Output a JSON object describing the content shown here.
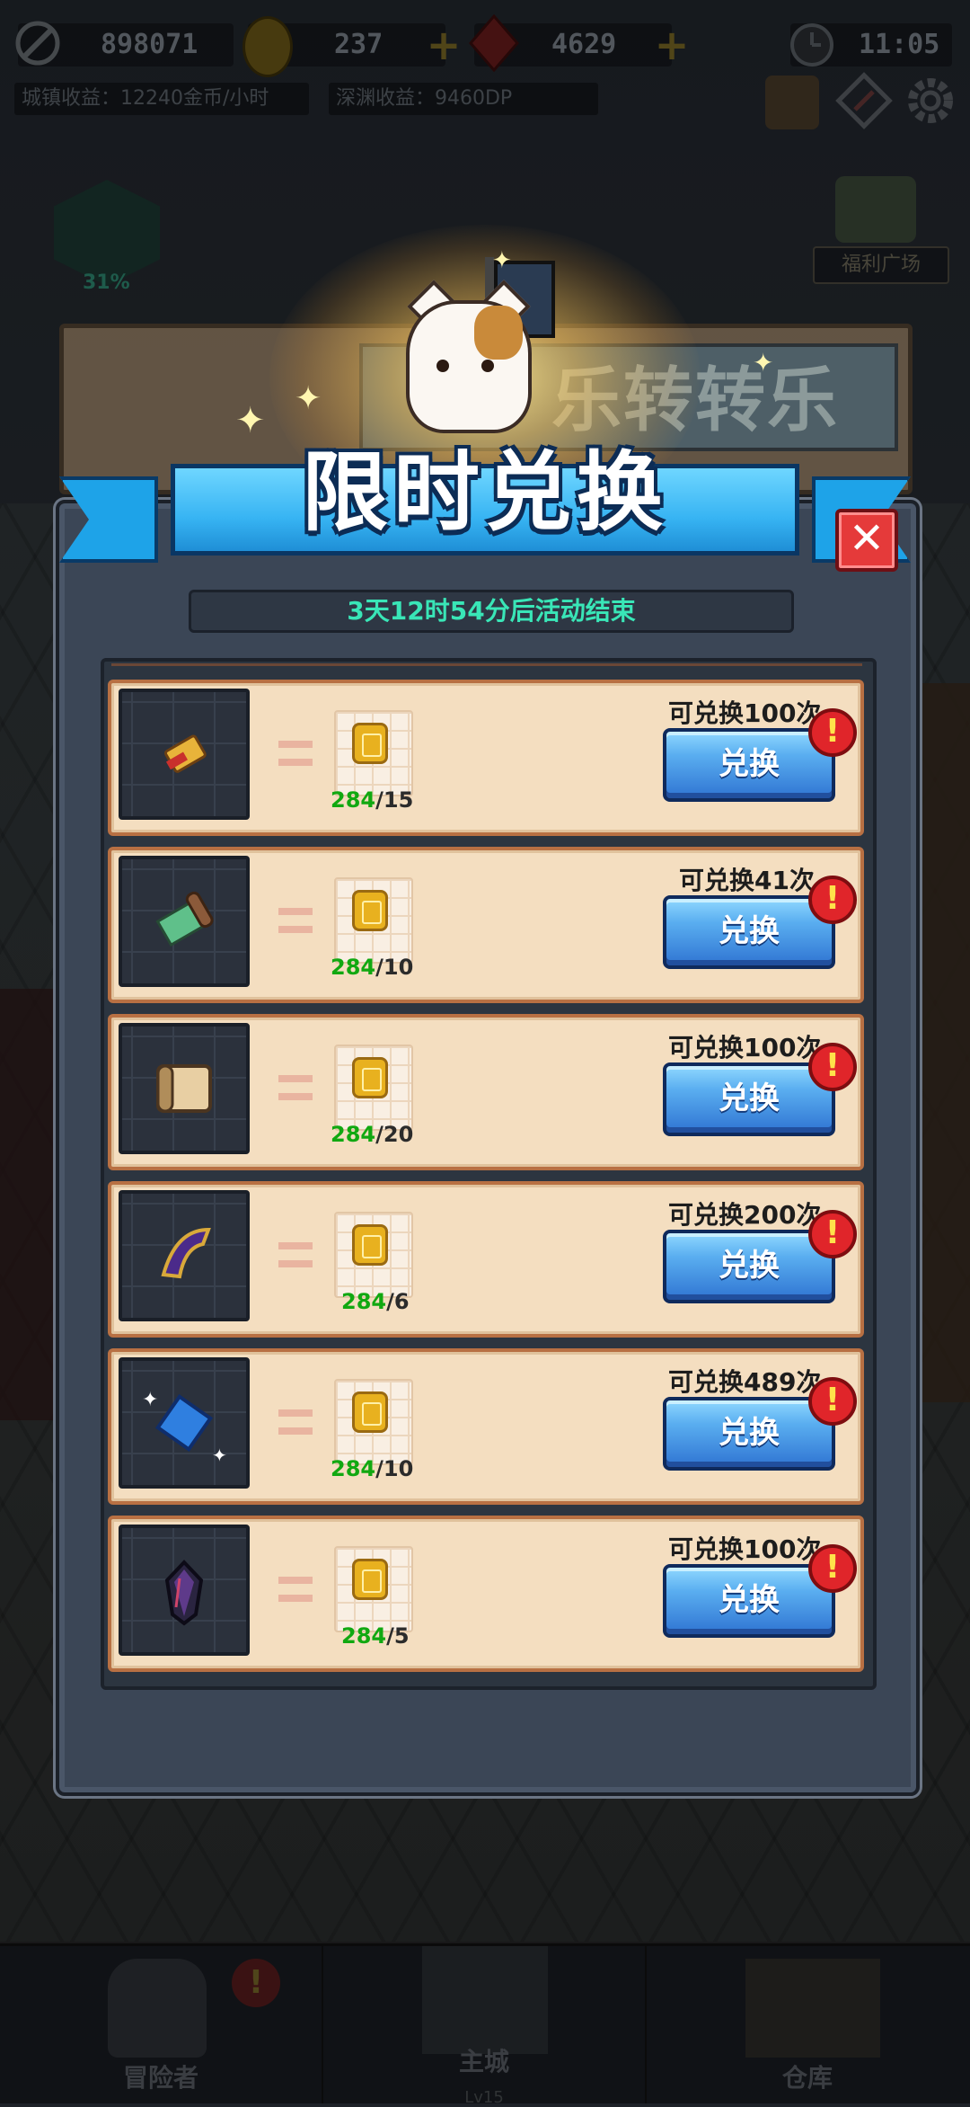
{
  "hud": {
    "power": "898071",
    "gold": "237",
    "gems": "4629",
    "time": "11:05",
    "town_income": "城镇收益：12240金币/小时",
    "abyss_income": "深渊收益：9460DP"
  },
  "side": {
    "progress": "31%",
    "welfare": "福利广场"
  },
  "header": {
    "old_sign": "乐转转乐",
    "title": "限时兑换"
  },
  "timer": "3天12时54分后活动结束",
  "items": [
    {
      "icon": "tag-icon",
      "have": "284",
      "need": "15",
      "limit": "可兑换100次",
      "button": "兑换",
      "alert": "!"
    },
    {
      "icon": "scroll-icon",
      "have": "284",
      "need": "10",
      "limit": "可兑换41次",
      "button": "兑换",
      "alert": "!"
    },
    {
      "icon": "map-scroll-icon",
      "have": "284",
      "need": "20",
      "limit": "可兑换100次",
      "button": "兑换",
      "alert": "!"
    },
    {
      "icon": "purple-scroll-icon",
      "have": "284",
      "need": "6",
      "limit": "可兑换200次",
      "button": "兑换",
      "alert": "!"
    },
    {
      "icon": "blue-crystal-ticket-icon",
      "have": "284",
      "need": "10",
      "limit": "可兑换489次",
      "button": "兑换",
      "alert": "!"
    },
    {
      "icon": "dark-gem-icon",
      "have": "284",
      "need": "5",
      "limit": "可兑换100次",
      "button": "兑换",
      "alert": "!"
    }
  ],
  "nav": {
    "adventurer": "冒险者",
    "main_city": "主城",
    "main_city_level": "Lv15",
    "warehouse": "仓库"
  }
}
